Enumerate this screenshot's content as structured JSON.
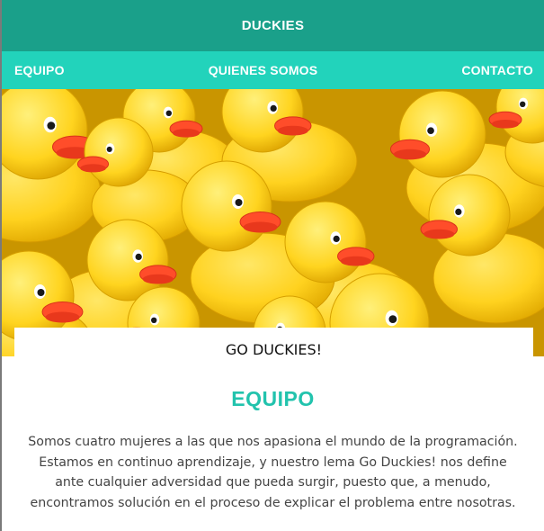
{
  "header": {
    "brand": "DUCKIES"
  },
  "nav": {
    "items": [
      {
        "label": "EQUIPO"
      },
      {
        "label": "QUIENES SOMOS"
      },
      {
        "label": "CONTACTO"
      }
    ]
  },
  "hero": {
    "image": "rubber-ducks-photo"
  },
  "tagline": "GO DUCKIES!",
  "section": {
    "title": "EQUIPO",
    "text": "Somos cuatro mujeres a las que nos apasiona el mundo de la programación. Estamos en continuo aprendizaje, y nuestro lema Go Duckies! nos define ante cualquier adversidad que pueda surgir, puesto que, a menudo, encontramos solución en el proceso de explicar el problema entre nosotras."
  },
  "colors": {
    "header_bg": "#1aa08a",
    "nav_bg": "#22d3bb",
    "accent": "#22c3ad",
    "duck_yellow": "#ffd21f",
    "beak": "#ff4d2a"
  }
}
